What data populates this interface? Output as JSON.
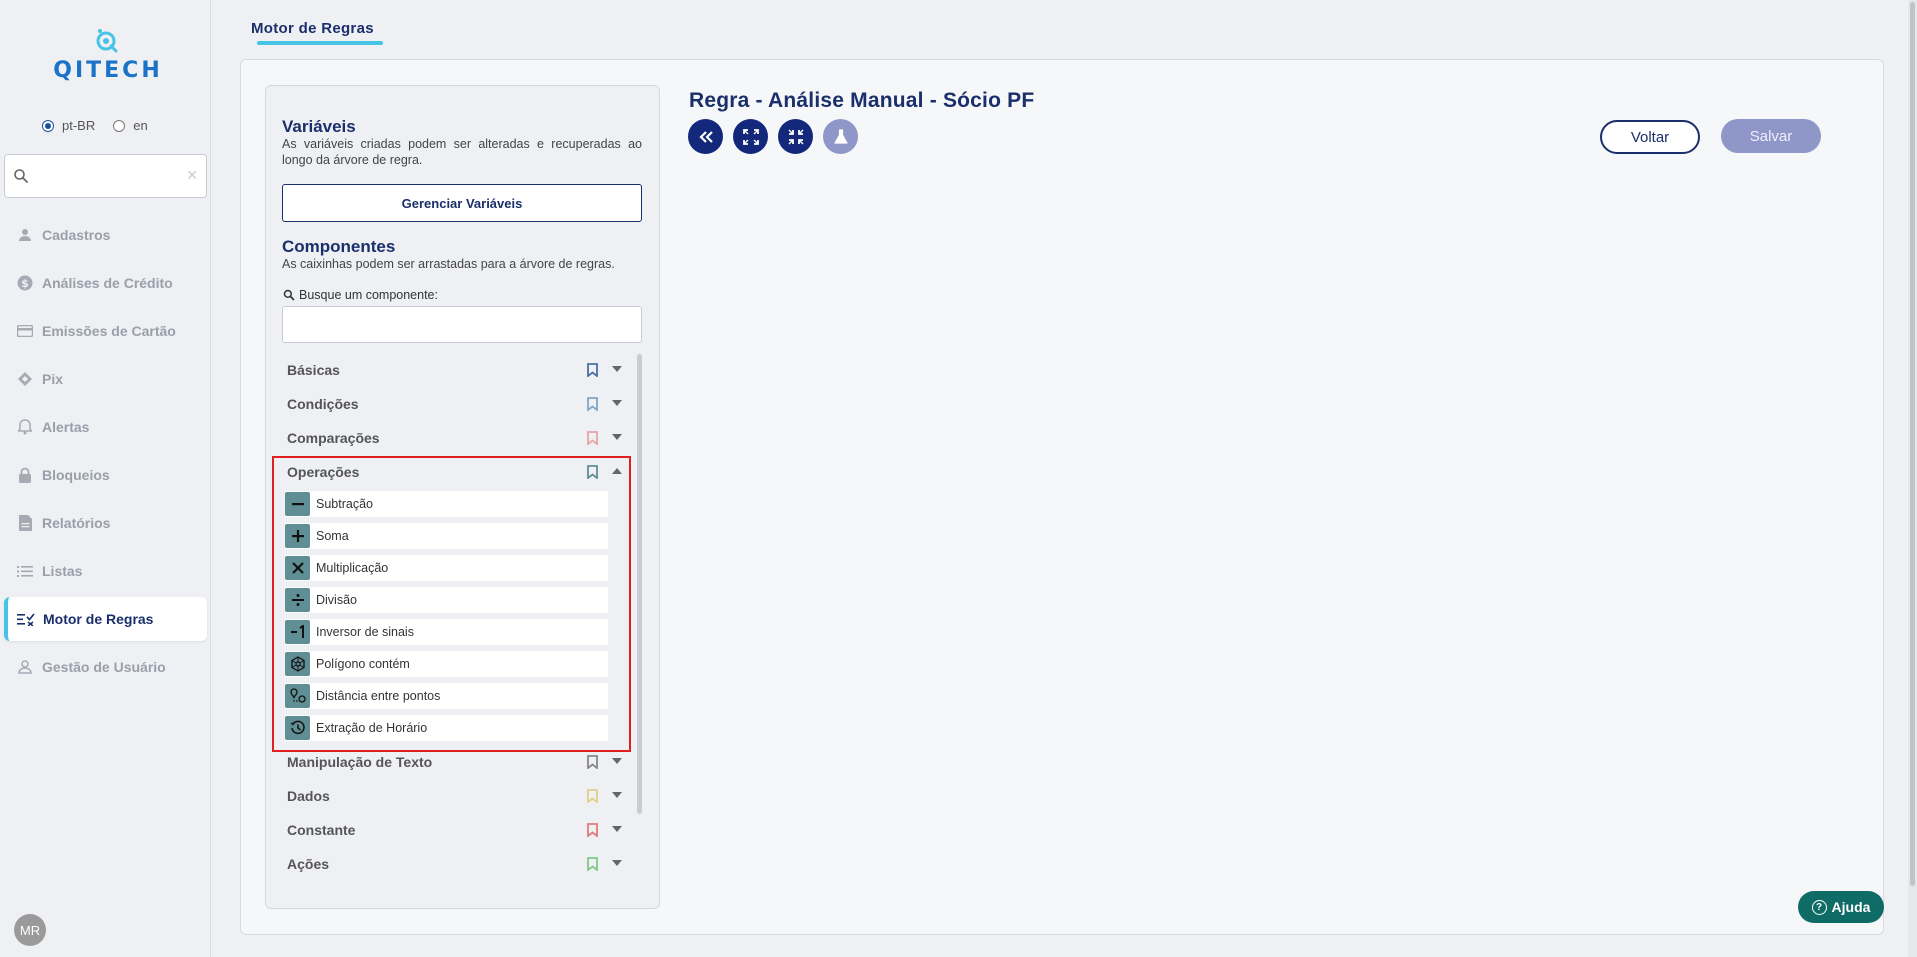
{
  "brand": {
    "name": "QITECH"
  },
  "language": {
    "options": [
      "pt-BR",
      "en"
    ],
    "selected": "pt-BR"
  },
  "sidebar": {
    "search_placeholder": "",
    "items": [
      {
        "label": "Cadastros",
        "icon": "person-icon",
        "active": false
      },
      {
        "label": "Análises de Crédito",
        "icon": "dollar-circle-icon",
        "active": false
      },
      {
        "label": "Emissões de Cartão",
        "icon": "credit-card-icon",
        "active": false
      },
      {
        "label": "Pix",
        "icon": "pix-icon",
        "active": false
      },
      {
        "label": "Alertas",
        "icon": "bell-icon",
        "active": false
      },
      {
        "label": "Bloqueios",
        "icon": "lock-icon",
        "active": false
      },
      {
        "label": "Relatórios",
        "icon": "document-icon",
        "active": false
      },
      {
        "label": "Listas",
        "icon": "list-icon",
        "active": false
      },
      {
        "label": "Motor de Regras",
        "icon": "rules-checklist-icon",
        "active": true
      },
      {
        "label": "Gestão de Usuário",
        "icon": "user-outline-icon",
        "active": false
      }
    ],
    "avatar_initials": "MR"
  },
  "page_tab": "Motor de Regras",
  "variables": {
    "title": "Variáveis",
    "description": "As variáveis criadas podem ser alteradas e recuperadas ao longo da árvore de regra.",
    "manage_button": "Gerenciar Variáveis"
  },
  "components": {
    "title": "Componentes",
    "description": "As caixinhas podem ser arrastadas para a árvore de regras.",
    "search_label": "Busque um componente:",
    "search_value": "",
    "categories": [
      {
        "label": "Básicas",
        "color": "#4a6fa5",
        "expanded": false
      },
      {
        "label": "Condições",
        "color": "#7fa7c9",
        "expanded": false
      },
      {
        "label": "Comparações",
        "color": "#e8a5a5",
        "expanded": false
      },
      {
        "label": "Operações",
        "color": "#5f8f94",
        "expanded": true
      },
      {
        "label": "Manipulação de Texto",
        "color": "#888888",
        "expanded": false
      },
      {
        "label": "Dados",
        "color": "#e0d08a",
        "expanded": false
      },
      {
        "label": "Constante",
        "color": "#e07a7a",
        "expanded": false
      },
      {
        "label": "Ações",
        "color": "#7fc98a",
        "expanded": false
      }
    ],
    "operations": [
      {
        "label": "Subtração",
        "icon": "minus-icon"
      },
      {
        "label": "Soma",
        "icon": "plus-icon"
      },
      {
        "label": "Multiplicação",
        "icon": "times-icon"
      },
      {
        "label": "Divisão",
        "icon": "divide-icon"
      },
      {
        "label": "Inversor de sinais",
        "icon": "sign-inverter-icon"
      },
      {
        "label": "Polígono contém",
        "icon": "polygon-icon"
      },
      {
        "label": "Distância entre pontos",
        "icon": "route-pins-icon"
      },
      {
        "label": "Extração de Horário",
        "icon": "clock-history-icon"
      }
    ]
  },
  "rule": {
    "title": "Regra - Análise Manual - Sócio PF",
    "toolbar": [
      "collapse-left-icon",
      "expand-icon",
      "compress-icon",
      "flask-icon"
    ],
    "back_label": "Voltar",
    "save_label": "Salvar"
  },
  "help_label": "Ajuda"
}
